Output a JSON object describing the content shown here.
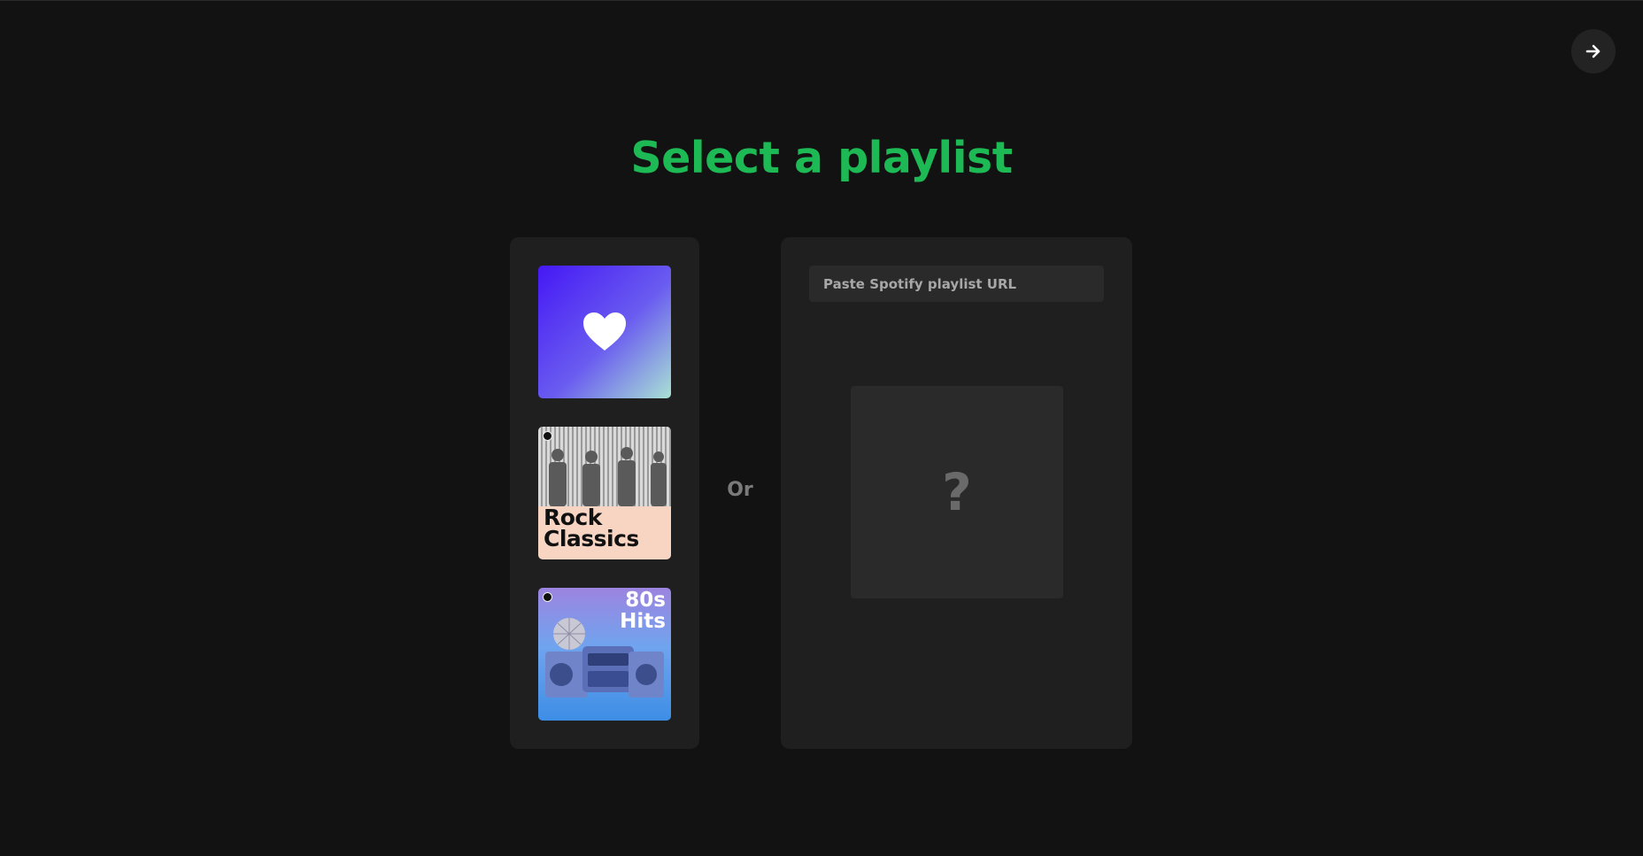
{
  "title": "Select a playlist",
  "next_button": {
    "icon": "arrow-right-icon"
  },
  "playlists": [
    {
      "name": "Liked Songs",
      "icon": "heart-icon",
      "label": ""
    },
    {
      "name": "Rock Classics",
      "label": "Rock\nClassics"
    },
    {
      "name": "80s Hits",
      "label": "80s\nHits"
    }
  ],
  "divider_text": "Or",
  "url_input": {
    "placeholder": "Paste Spotify playlist URL",
    "value": ""
  },
  "preview": {
    "placeholder_symbol": "?"
  },
  "colors": {
    "accent": "#1db954",
    "background": "#121212",
    "panel": "#1f1f1f",
    "input": "#2a2a2a"
  }
}
